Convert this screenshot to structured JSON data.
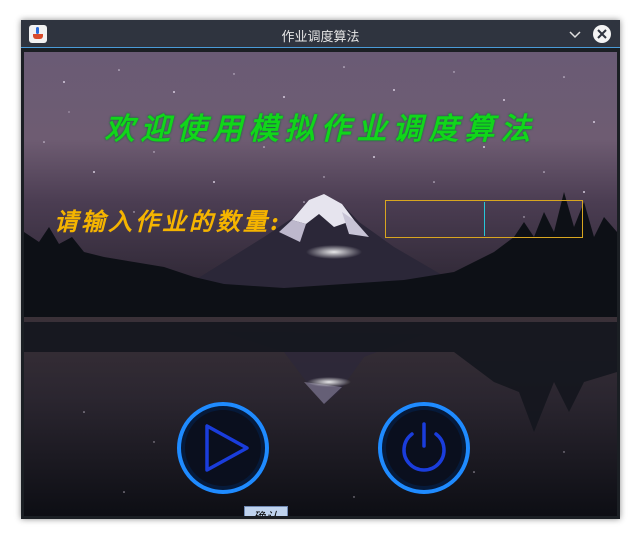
{
  "window": {
    "title": "作业调度算法"
  },
  "titlebar": {
    "minimize_icon": "chevron-down-icon",
    "close_icon": "close-icon",
    "app_icon": "java-cup-icon"
  },
  "main": {
    "welcome_text": "欢迎使用模拟作业调度算法",
    "prompt_label": "请输入作业的数量:",
    "job_count_value": "",
    "confirm_label": "确认",
    "play_icon": "play-icon",
    "power_icon": "power-icon"
  },
  "colors": {
    "welcome": "#11d61a",
    "prompt": "#f5b400",
    "input_border": "#d8a620",
    "button_blue": "#1a3ddc",
    "button_ring": "#1f8bff"
  }
}
